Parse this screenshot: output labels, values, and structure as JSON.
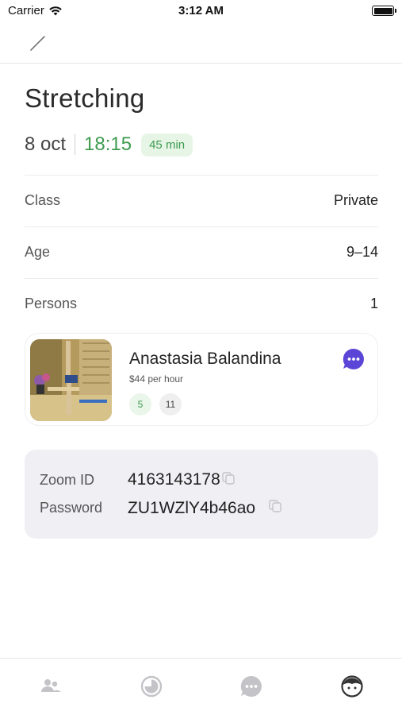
{
  "status_bar": {
    "carrier": "Carrier",
    "time": "3:12 AM"
  },
  "nav": {
    "back_icon": "slash-icon"
  },
  "lesson": {
    "title": "Stretching",
    "date": "8 oct",
    "time": "18:15",
    "duration": "45 min"
  },
  "details": [
    {
      "label": "Class",
      "value": "Private"
    },
    {
      "label": "Age",
      "value": "9–14"
    },
    {
      "label": "Persons",
      "value": "1"
    }
  ],
  "trainer": {
    "name": "Anastasia Balandina",
    "rate": "$44 per hour",
    "badge_green": "5",
    "badge_grey": "11"
  },
  "zoom": {
    "id_label": "Zoom ID",
    "id_value": "4163143178",
    "password_label": "Password",
    "password_value": "ZU1WZlY4b46ao"
  },
  "tabs": [
    "people-icon",
    "progress-icon",
    "chat-icon",
    "profile-icon"
  ],
  "colors": {
    "accent_green": "#3e9b4f",
    "chat_purple": "#5b45d6",
    "zoom_bg": "#efeff4"
  }
}
